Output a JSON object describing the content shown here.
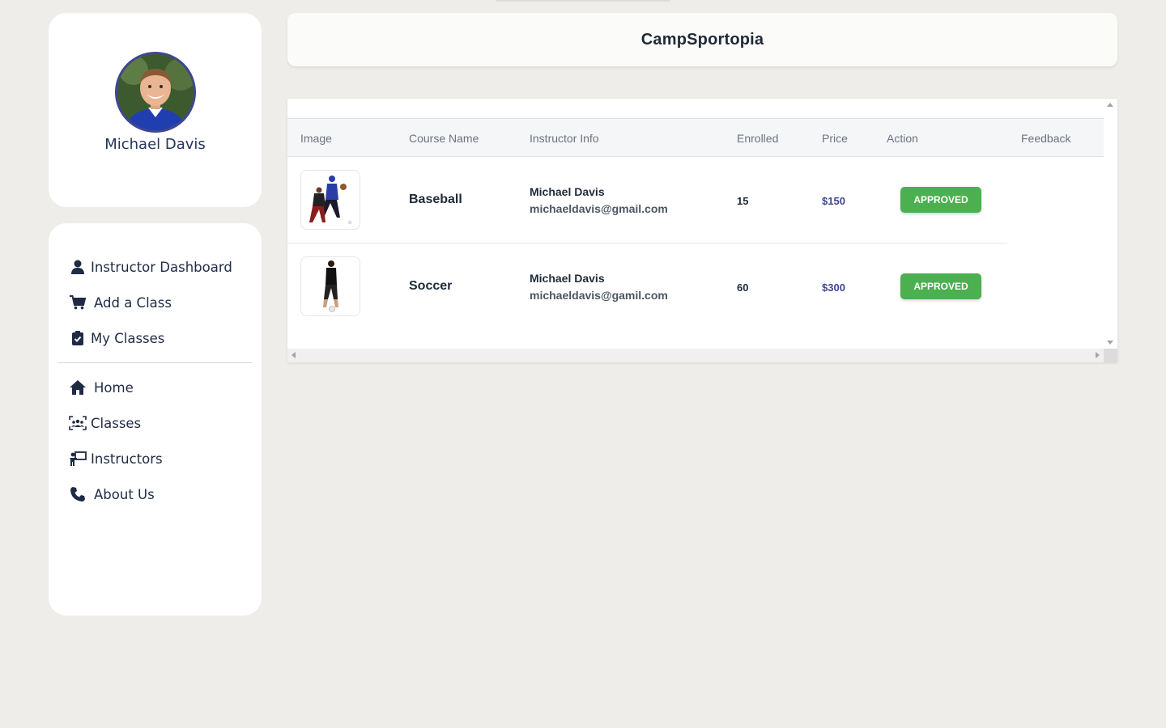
{
  "profile": {
    "name": "Michael Davis"
  },
  "nav": {
    "dashboard_items": [
      {
        "label": "Instructor Dashboard",
        "icon": "user-icon"
      },
      {
        "label": "Add a Class",
        "icon": "cart-icon"
      },
      {
        "label": "My Classes",
        "icon": "clipboard-check-icon"
      }
    ],
    "main_items": [
      {
        "label": "Home",
        "icon": "home-icon"
      },
      {
        "label": "Classes",
        "icon": "group-icon"
      },
      {
        "label": "Instructors",
        "icon": "chalkboard-teacher-icon"
      },
      {
        "label": "About Us",
        "icon": "phone-icon"
      }
    ]
  },
  "header": {
    "title": "CampSportopia"
  },
  "table": {
    "columns": [
      "Image",
      "Course Name",
      "Instructor Info",
      "Enrolled",
      "Price",
      "Action",
      "Feedback"
    ],
    "rows": [
      {
        "course": "Baseball",
        "instructor_name": "Michael Davis",
        "instructor_email": "michaeldavis@gmail.com",
        "enrolled": "15",
        "price": "$150",
        "status": "APPROVED",
        "feedback": ""
      },
      {
        "course": "Soccer",
        "instructor_name": "Michael Davis",
        "instructor_email": "michaeldavis@gamil.com",
        "enrolled": "60",
        "price": "$300",
        "status": "APPROVED",
        "feedback": ""
      }
    ]
  },
  "colors": {
    "accent": "#3f4690",
    "approved": "#4caf50",
    "background": "#eeede9"
  }
}
